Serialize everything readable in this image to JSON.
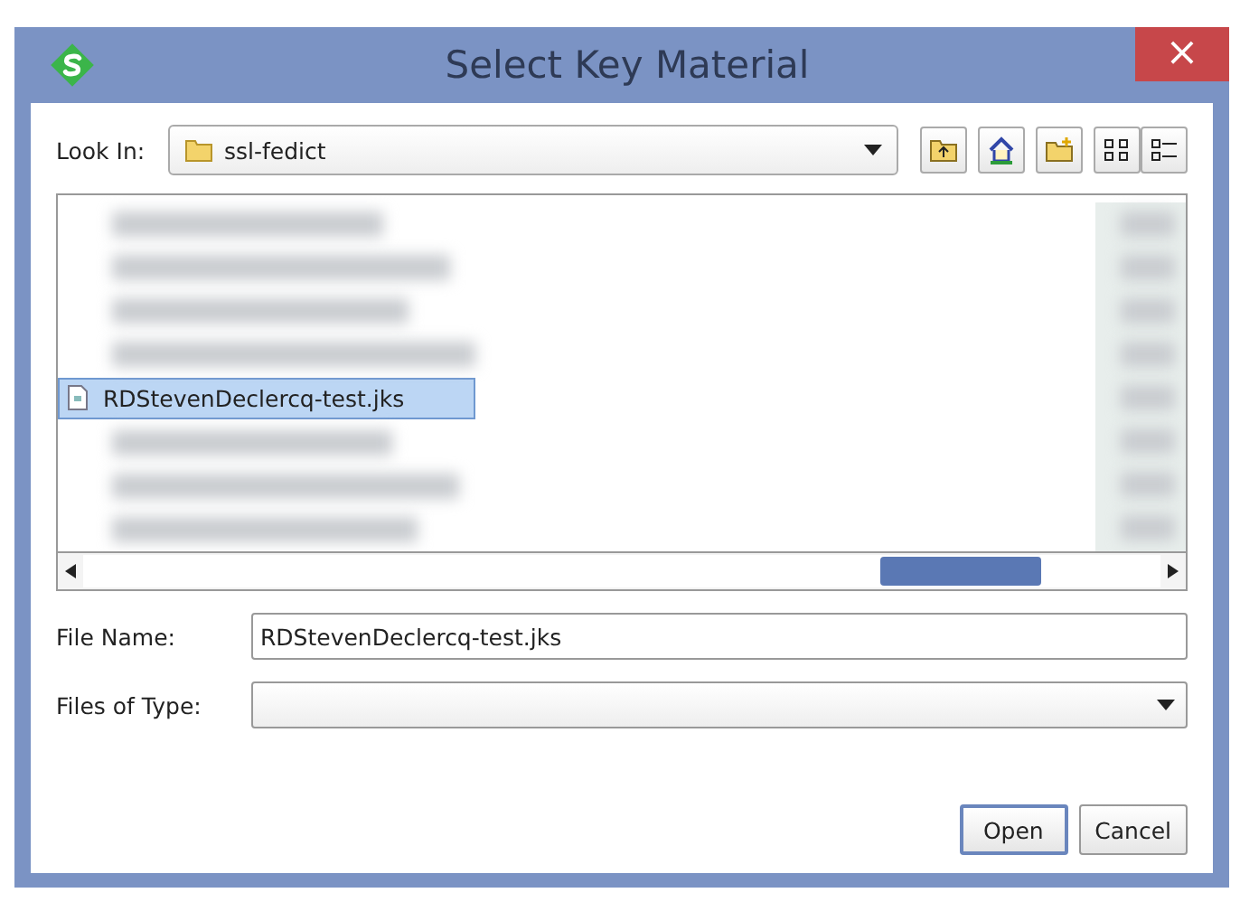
{
  "window": {
    "title": "Select Key Material",
    "close": "×"
  },
  "look_in": {
    "label": "Look In:",
    "value": "ssl-fedict"
  },
  "file_list": {
    "entries": [
      {
        "kind": "blurred",
        "selected": false
      },
      {
        "kind": "blurred",
        "selected": false
      },
      {
        "kind": "blurred",
        "selected": false
      },
      {
        "kind": "blurred",
        "selected": false
      },
      {
        "kind": "file",
        "name": "RDStevenDeclercq-test.jks",
        "selected": true
      },
      {
        "kind": "blurred",
        "selected": false
      },
      {
        "kind": "blurred",
        "selected": false
      },
      {
        "kind": "blurred",
        "selected": false
      }
    ]
  },
  "file_name": {
    "label": "File Name:",
    "value": "RDStevenDeclercq-test.jks"
  },
  "files_of_type": {
    "label": "Files of Type:"
  },
  "buttons": [
    {
      "label": "Open",
      "default": true
    },
    {
      "label": "Cancel",
      "default": false
    }
  ]
}
